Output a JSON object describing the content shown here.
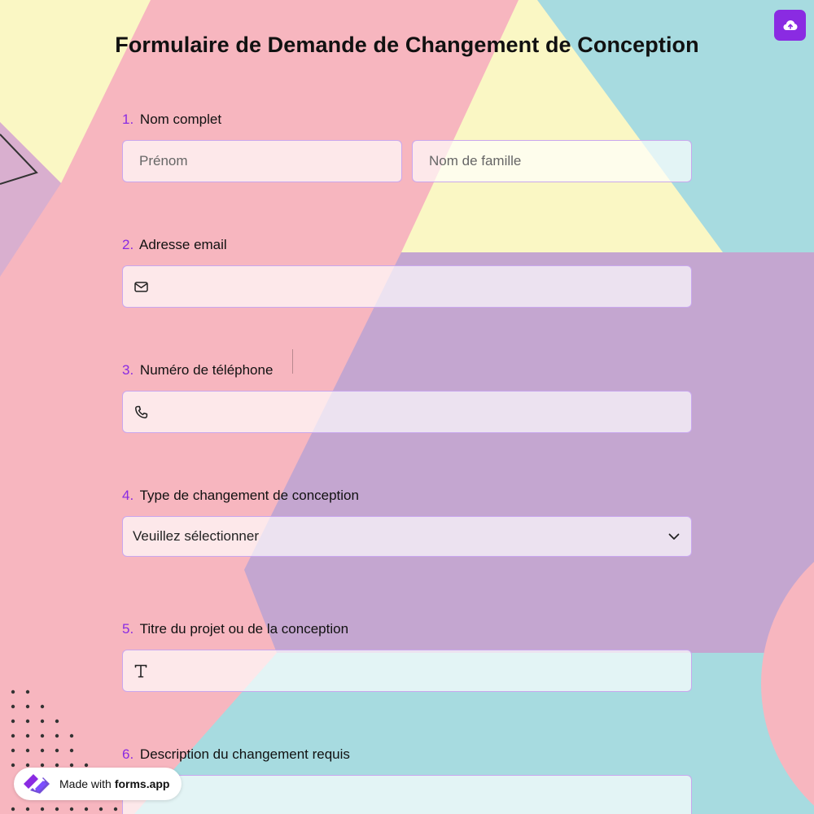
{
  "form": {
    "title": "Formulaire de Demande de Changement de Conception",
    "upload_button_icon": "cloud-upload-icon"
  },
  "questions": [
    {
      "number": "1.",
      "label": "Nom complet",
      "fields": [
        {
          "placeholder": "Prénom"
        },
        {
          "placeholder": "Nom de famille"
        }
      ]
    },
    {
      "number": "2.",
      "label": "Adresse email",
      "icon": "mail-icon",
      "value": ""
    },
    {
      "number": "3.",
      "label": "Numéro de téléphone",
      "icon": "phone-icon",
      "value": ""
    },
    {
      "number": "4.",
      "label": "Type de changement de conception",
      "selected": "Veuillez sélectionner",
      "icon": "chevron-down-icon"
    },
    {
      "number": "5.",
      "label": "Titre du projet ou de la conception",
      "icon": "text-icon",
      "value": ""
    },
    {
      "number": "6.",
      "label": "Description du changement requis",
      "value": ""
    }
  ],
  "badge": {
    "prefix": "Made with",
    "brand": "forms.app",
    "icon": "forms-app-logo-icon"
  },
  "colors": {
    "accent": "#8a2be2",
    "pink": "#f7b6bf",
    "yellow": "#faf7c4",
    "teal": "#a7dbe0",
    "purple": "#c4a6d0"
  }
}
